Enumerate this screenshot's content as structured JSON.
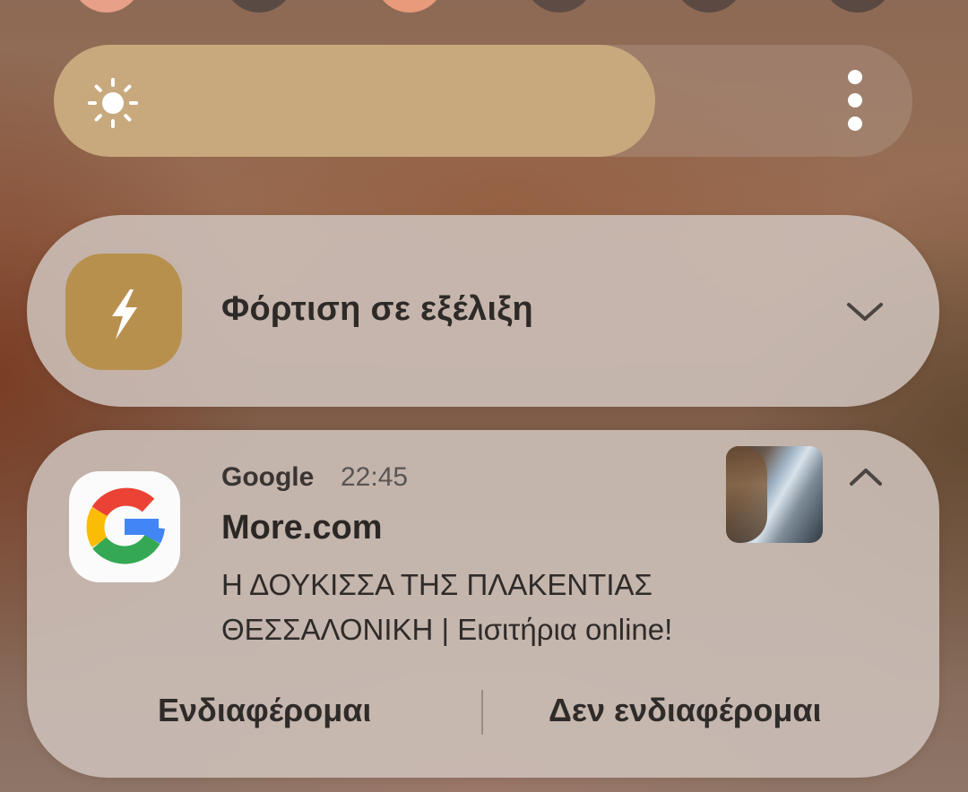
{
  "brightness": {
    "level": 0.7,
    "fill_color": "#c8a97e",
    "icon": "sun-icon",
    "menu_icon": "more-vertical-icon"
  },
  "quick_settings_colors": [
    "#e8a088",
    "#5a4a44",
    "#e89a7a",
    "#5e4c44",
    "#5c4a42",
    "#5a4842"
  ],
  "charging_notification": {
    "icon": "lightning-icon",
    "icon_bg_color": "#b8904e",
    "title": "Φόρτιση σε εξέλιξη",
    "expand_icon": "chevron-down-icon"
  },
  "google_notification": {
    "app_icon": "google-logo-icon",
    "app_name": "Google",
    "time": "22:45",
    "title": "More.com",
    "body": "Η ΔΟΥΚΙΣΣΑ ΤΗΣ ΠΛΑΚΕΝΤΙΑΣ ΘΕΣΣΑΛΟΝΙΚΗ | Εισιτήρια online!",
    "collapse_icon": "chevron-up-icon",
    "actions": {
      "interested": "Ενδιαφέρομαι",
      "not_interested": "Δεν ενδιαφέρομαι"
    }
  }
}
